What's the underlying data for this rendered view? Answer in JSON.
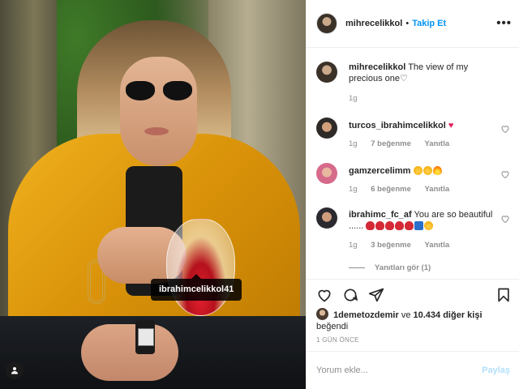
{
  "photo": {
    "tag_label": "ibrahimcelikkol41"
  },
  "header": {
    "username": "mihrecelikkol",
    "separator": "•",
    "follow_label": "Takip Et",
    "more_label": "•••"
  },
  "caption": {
    "username": "mihrecelikkol",
    "text": "The view of my precious one♡",
    "time": "1g"
  },
  "comments": [
    {
      "username": "turcos_ibrahimcelikkol",
      "text": "",
      "time": "1g",
      "likes": "7 beğenme",
      "reply_label": "Yanıtla"
    },
    {
      "username": "gamzercelimm",
      "text": "",
      "time": "1g",
      "likes": "6 beğenme",
      "reply_label": "Yanıtla"
    },
    {
      "username": "ibrahimc_fc_af",
      "text": "You are so beautiful ......",
      "time": "1g",
      "likes": "3 beğenme",
      "reply_label": "Yanıtla"
    }
  ],
  "view_replies_label": "Yanıtları gör (1)",
  "likes": {
    "liker": "1demetozdemir",
    "connector": "ve",
    "others": "10.434 diğer kişi",
    "suffix": "beğendi"
  },
  "timestamp": "1 GÜN ÖNCE",
  "comment_input": {
    "placeholder": "Yorum ekle...",
    "post_label": "Paylaş"
  },
  "icons": {
    "heart": "heart-icon",
    "comment": "comment-icon",
    "share": "share-icon",
    "save": "bookmark-icon",
    "user_tag": "user-tag-icon"
  },
  "colors": {
    "accent": "#0095f6",
    "post_disabled": "#b2dffc",
    "muted": "#8e8e8e",
    "text": "#262626",
    "jacket": "#e0a010"
  }
}
